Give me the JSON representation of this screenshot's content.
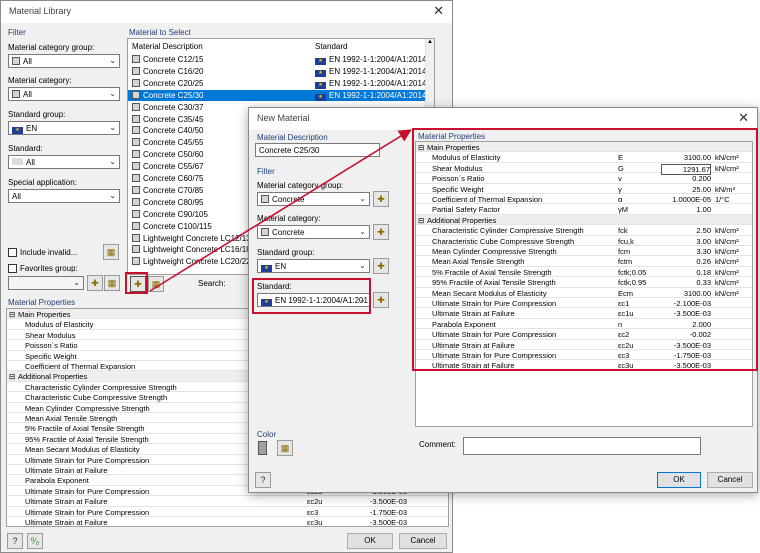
{
  "material_library": {
    "title": "Material Library",
    "filter_header": "Filter",
    "material_category_group_label": "Material category group:",
    "material_category_group_value": "All",
    "material_category_label": "Material category:",
    "material_category_value": "All",
    "standard_group_label": "Standard group:",
    "standard_group_value": "EN",
    "standard_label": "Standard:",
    "standard_value": "All",
    "special_application_label": "Special application:",
    "special_application_value": "All",
    "include_invalid_label": "Include invalid...",
    "favorites_group_label": "Favorites group:",
    "material_to_select_header": "Material to Select",
    "col_description": "Material Description",
    "col_standard": "Standard",
    "materials": [
      {
        "name": "Concrete C12/15",
        "standard": "EN 1992-1-1:2004/A1:2014"
      },
      {
        "name": "Concrete C16/20",
        "standard": "EN 1992-1-1:2004/A1:2014"
      },
      {
        "name": "Concrete C20/25",
        "standard": "EN 1992-1-1:2004/A1:2014"
      },
      {
        "name": "Concrete C25/30",
        "standard": "EN 1992-1-1:2004/A1:2014"
      },
      {
        "name": "Concrete C30/37",
        "standard": ""
      },
      {
        "name": "Concrete C35/45",
        "standard": ""
      },
      {
        "name": "Concrete C40/50",
        "standard": ""
      },
      {
        "name": "Concrete C45/55",
        "standard": ""
      },
      {
        "name": "Concrete C50/60",
        "standard": ""
      },
      {
        "name": "Concrete C55/67",
        "standard": ""
      },
      {
        "name": "Concrete C60/75",
        "standard": ""
      },
      {
        "name": "Concrete C70/85",
        "standard": ""
      },
      {
        "name": "Concrete C80/95",
        "standard": ""
      },
      {
        "name": "Concrete C90/105",
        "standard": ""
      },
      {
        "name": "Concrete C100/115",
        "standard": ""
      },
      {
        "name": "Lightweight Concrete LC12/13",
        "standard": ""
      },
      {
        "name": "Lightweight Concrete LC16/18",
        "standard": ""
      },
      {
        "name": "Lightweight Concrete LC20/22",
        "standard": ""
      }
    ],
    "selected_index": 3,
    "search_label": "Search:",
    "properties_header": "Material Properties",
    "main_properties_label": "Main Properties",
    "main_properties": [
      "Modulus of Elasticity",
      "Shear Modulus",
      "Poisson´s Ratio",
      "Specific Weight",
      "Coefficient of Thermal Expansion"
    ],
    "additional_properties_label": "Additional Properties",
    "additional_properties": [
      {
        "name": "Characteristic Cylinder Compressive Strength",
        "symbol": "",
        "value": ""
      },
      {
        "name": "Characteristic Cube Compressive Strength",
        "symbol": "",
        "value": ""
      },
      {
        "name": "Mean Cylinder Compressive Strength",
        "symbol": "",
        "value": ""
      },
      {
        "name": "Mean Axial Tensile Strength",
        "symbol": "",
        "value": ""
      },
      {
        "name": "5% Fractile of Axial Tensile Strength",
        "symbol": "",
        "value": ""
      },
      {
        "name": "95% Fractile of Axial Tensile Strength",
        "symbol": "",
        "value": ""
      },
      {
        "name": "Mean Secant Modulus of Elasticity",
        "symbol": "",
        "value": ""
      },
      {
        "name": "Ultimate Strain for Pure Compression",
        "symbol": "",
        "value": ""
      },
      {
        "name": "Ultimate Strain at Failure",
        "symbol": "",
        "value": ""
      },
      {
        "name": "Parabola Exponent",
        "symbol": "",
        "value": ""
      },
      {
        "name": "Ultimate Strain for Pure Compression",
        "symbol": "εc2u",
        "value": "-3.500E-03"
      },
      {
        "name": "Ultimate Strain at Failure",
        "symbol": "εc2u",
        "value": "-3.500E-03"
      },
      {
        "name": "Ultimate Strain for Pure Compression",
        "symbol": "εc3",
        "value": "-1.750E-03"
      },
      {
        "name": "Ultimate Strain at Failure",
        "symbol": "εc3u",
        "value": "-3.500E-03"
      }
    ],
    "ok_label": "OK",
    "cancel_label": "Cancel"
  },
  "new_material": {
    "title": "New Material",
    "material_description_header": "Material Description",
    "material_description_value": "Concrete C25/30",
    "filter_header": "Filter",
    "material_category_group_label": "Material category group:",
    "material_category_group_value": "Concrete",
    "material_category_label": "Material category:",
    "material_category_value": "Concrete",
    "standard_group_label": "Standard group:",
    "standard_group_value": "EN",
    "standard_label": "Standard:",
    "standard_value": "EN 1992-1-1:2004/A1:201",
    "color_header": "Color",
    "properties_header": "Material Properties",
    "main_properties_label": "Main Properties",
    "main_properties": [
      {
        "name": "Modulus of Elasticity",
        "symbol": "E",
        "value": "3100.00",
        "unit": "kN/cm²"
      },
      {
        "name": "Shear Modulus",
        "symbol": "G",
        "value": "1291.67",
        "unit": "kN/cm²"
      },
      {
        "name": "Poisson´s Ratio",
        "symbol": "ν",
        "value": "0.200",
        "unit": ""
      },
      {
        "name": "Specific Weight",
        "symbol": "γ",
        "value": "25.00",
        "unit": "kN/m³"
      },
      {
        "name": "Coefficient of Thermal Expansion",
        "symbol": "α",
        "value": "1.0000E-05",
        "unit": "1/°C"
      },
      {
        "name": "Partial Safety Factor",
        "symbol": "γM",
        "value": "1.00",
        "unit": ""
      }
    ],
    "additional_properties_label": "Additional Properties",
    "additional_properties": [
      {
        "name": "Characteristic Cylinder Compressive Strength",
        "symbol": "fck",
        "value": "2.50",
        "unit": "kN/cm²"
      },
      {
        "name": "Characteristic Cube Compressive Strength",
        "symbol": "fcu,k",
        "value": "3.00",
        "unit": "kN/cm²"
      },
      {
        "name": "Mean Cylinder Compressive Strength",
        "symbol": "fcm",
        "value": "3.30",
        "unit": "kN/cm²"
      },
      {
        "name": "Mean Axial Tensile Strength",
        "symbol": "fctm",
        "value": "0.26",
        "unit": "kN/cm²"
      },
      {
        "name": "5% Fractile of Axial Tensile Strength",
        "symbol": "fctk;0.05",
        "value": "0.18",
        "unit": "kN/cm²"
      },
      {
        "name": "95% Fractile of Axial Tensile Strength",
        "symbol": "fctk;0.95",
        "value": "0.33",
        "unit": "kN/cm²"
      },
      {
        "name": "Mean Secant Modulus of Elasticity",
        "symbol": "Ecm",
        "value": "3100.00",
        "unit": "kN/cm²"
      },
      {
        "name": "Ultimate Strain for Pure Compression",
        "symbol": "εc1",
        "value": "-2.100E-03",
        "unit": ""
      },
      {
        "name": "Ultimate Strain at Failure",
        "symbol": "εc1u",
        "value": "-3.500E-03",
        "unit": ""
      },
      {
        "name": "Parabola Exponent",
        "symbol": "n",
        "value": "2.000",
        "unit": ""
      },
      {
        "name": "Ultimate Strain for Pure Compression",
        "symbol": "εc2",
        "value": "-0.002",
        "unit": ""
      },
      {
        "name": "Ultimate Strain at Failure",
        "symbol": "εc2u",
        "value": "-3.500E-03",
        "unit": ""
      },
      {
        "name": "Ultimate Strain for Pure Compression",
        "symbol": "εc3",
        "value": "-1.750E-03",
        "unit": ""
      },
      {
        "name": "Ultimate Strain at Failure",
        "symbol": "εc3u",
        "value": "-3.500E-03",
        "unit": ""
      }
    ],
    "comment_label": "Comment:",
    "ok_label": "OK",
    "cancel_label": "Cancel"
  },
  "colors": {
    "accent": "#0078d7",
    "highlight": "#c8102e",
    "section_header": "#1f3f77"
  }
}
